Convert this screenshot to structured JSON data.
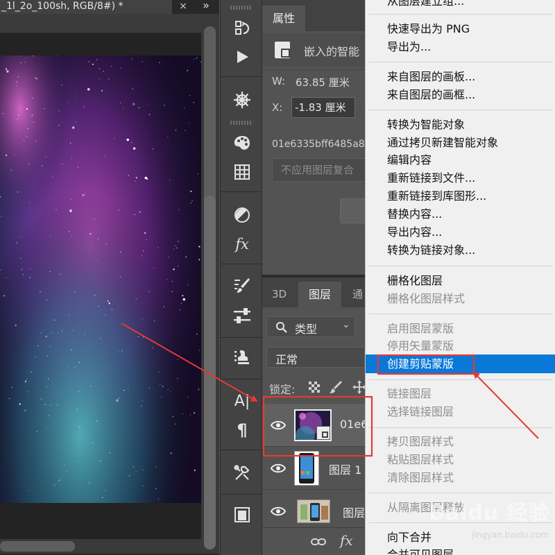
{
  "document": {
    "tab_title": "_1l_2o_100sh, RGB/8#) *",
    "tab_close": "×",
    "tab_overflow": "»"
  },
  "toolbar": {
    "tools": [
      {
        "name": "history-brush-icon"
      },
      {
        "name": "play-icon"
      },
      {
        "name": "compass-icon"
      },
      {
        "name": "palette-icon"
      },
      {
        "name": "grid-icon"
      },
      {
        "name": "adjustment-icon"
      },
      {
        "name": "fx-icon",
        "label": "fx"
      },
      {
        "name": "brush-settings-icon"
      },
      {
        "name": "sliders-icon"
      },
      {
        "name": "stamp-icon"
      },
      {
        "name": "character-icon",
        "label": "A|"
      },
      {
        "name": "paragraph-icon",
        "label": "¶"
      },
      {
        "name": "tools-icon"
      },
      {
        "name": "export-icon"
      }
    ]
  },
  "properties": {
    "tab_label": "属性",
    "object_label": "嵌入的智能",
    "w_label": "W:",
    "w_value": "63.85 厘米",
    "x_label": "X:",
    "x_value": "-1.83 厘米",
    "filename": "01e6335bff6485a8",
    "layer_comp_placeholder": "不应用图层复合"
  },
  "layers": {
    "tabs": {
      "t3d": "3D",
      "layers": "图层",
      "channels": "通"
    },
    "filter_label": "类型",
    "filter_chevron": "⌄",
    "blend_mode": "正常",
    "lock_label": "锁定:",
    "rows": [
      {
        "name": "01e6",
        "selected": true
      },
      {
        "name": "图层 1"
      },
      {
        "name": "图层"
      }
    ],
    "footer_fx": "fx"
  },
  "menu": {
    "items": [
      {
        "label": "从图层建立组...",
        "disabled": false
      },
      {
        "label": "快速导出为 PNG",
        "disabled": false
      },
      {
        "label": "导出为...",
        "disabled": false
      },
      {
        "label": "来自图层的画板...",
        "disabled": false
      },
      {
        "label": "来自图层的画框...",
        "disabled": false
      },
      {
        "label": "转换为智能对象",
        "disabled": false
      },
      {
        "label": "通过拷贝新建智能对象",
        "disabled": false
      },
      {
        "label": "编辑内容",
        "disabled": false
      },
      {
        "label": "重新链接到文件...",
        "disabled": false
      },
      {
        "label": "重新链接到库图形...",
        "disabled": false
      },
      {
        "label": "替换内容...",
        "disabled": false
      },
      {
        "label": "导出内容...",
        "disabled": false
      },
      {
        "label": "转换为链接对象...",
        "disabled": false
      },
      {
        "label": "栅格化图层",
        "disabled": false
      },
      {
        "label": "栅格化图层样式",
        "disabled": true
      },
      {
        "label": "启用图层蒙版",
        "disabled": true
      },
      {
        "label": "停用矢量蒙版",
        "disabled": true
      },
      {
        "label": "创建剪贴蒙版",
        "disabled": false,
        "highlighted": true
      },
      {
        "label": "链接图层",
        "disabled": true
      },
      {
        "label": "选择链接图层",
        "disabled": true
      },
      {
        "label": "拷贝图层样式",
        "disabled": true
      },
      {
        "label": "粘贴图层样式",
        "disabled": true
      },
      {
        "label": "清除图层样式",
        "disabled": true
      },
      {
        "label": "从隔离图层释放",
        "disabled": true
      },
      {
        "label": "向下合并",
        "disabled": false
      },
      {
        "label": "合并可见图层",
        "disabled": false
      }
    ]
  },
  "watermark": {
    "brand": "Baidu 经验",
    "site": "jingyan.baidu.com"
  },
  "colors": {
    "menu_highlight": "#0a78d7",
    "annotation_red": "#e53935"
  }
}
